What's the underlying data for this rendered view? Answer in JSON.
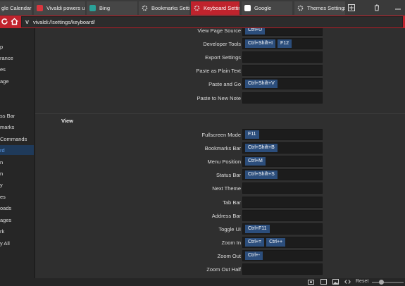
{
  "tabs": [
    {
      "label": "gle Calendar",
      "color": "#4a86e8"
    },
    {
      "label": "Vivaldi powers up t",
      "color": "#d9363e"
    },
    {
      "label": "Bing",
      "color": "#2aa198"
    },
    {
      "label": "Bookmarks Setting",
      "icon": "gear-icon"
    },
    {
      "label": "Keyboard Settings",
      "icon": "gear-icon",
      "active": true
    },
    {
      "label": "Google",
      "color": "#ffffff"
    },
    {
      "label": "Themes Settings",
      "icon": "gear-icon"
    }
  ],
  "address": {
    "prefix": "V",
    "url": "vivaldi://settings/keyboard/"
  },
  "sidebar": [
    {
      "label": "p"
    },
    {
      "label": "rance"
    },
    {
      "label": "es"
    },
    {
      "label": "age"
    },
    {
      "label": "ss Bar"
    },
    {
      "label": "marks"
    },
    {
      "label": "Commands"
    },
    {
      "label": "rd",
      "selected": true
    },
    {
      "label": "n"
    },
    {
      "label": "n"
    },
    {
      "label": "y"
    },
    {
      "label": "es"
    },
    {
      "label": "oads"
    },
    {
      "label": "ages"
    },
    {
      "label": "rk"
    },
    {
      "label": "y All"
    }
  ],
  "top_rows": [
    {
      "label": "View Page Source",
      "keys": [
        "Ctrl+U"
      ]
    },
    {
      "label": "Developer Tools",
      "keys": [
        "Ctrl+Shift+I",
        "F12"
      ]
    },
    {
      "label": "Export Settings",
      "keys": []
    },
    {
      "label": "Paste as Plain Text",
      "keys": []
    },
    {
      "label": "Paste and Go",
      "keys": [
        "Ctrl+Shift+V"
      ]
    },
    {
      "label": "Paste to New Note",
      "keys": []
    }
  ],
  "view_section": {
    "title": "View",
    "rows": [
      {
        "label": "Fullscreen Mode",
        "keys": [
          "F11"
        ]
      },
      {
        "label": "Bookmarks Bar",
        "keys": [
          "Ctrl+Shift+B"
        ]
      },
      {
        "label": "Menu Position",
        "keys": [
          "Ctrl+M"
        ]
      },
      {
        "label": "Status Bar",
        "keys": [
          "Ctrl+Shift+S"
        ]
      },
      {
        "label": "Next Theme",
        "keys": []
      },
      {
        "label": "Tab Bar",
        "keys": []
      },
      {
        "label": "Address Bar",
        "keys": []
      },
      {
        "label": "Toggle UI",
        "keys": [
          "Ctrl+F11"
        ]
      },
      {
        "label": "Zoom In",
        "keys": [
          "Ctrl+=",
          "Ctrl++"
        ]
      },
      {
        "label": "Zoom Out",
        "keys": [
          "Ctrl+-"
        ]
      },
      {
        "label": "Zoom Out Half",
        "keys": []
      }
    ]
  },
  "statusbar": {
    "reset_label": "Reset"
  }
}
